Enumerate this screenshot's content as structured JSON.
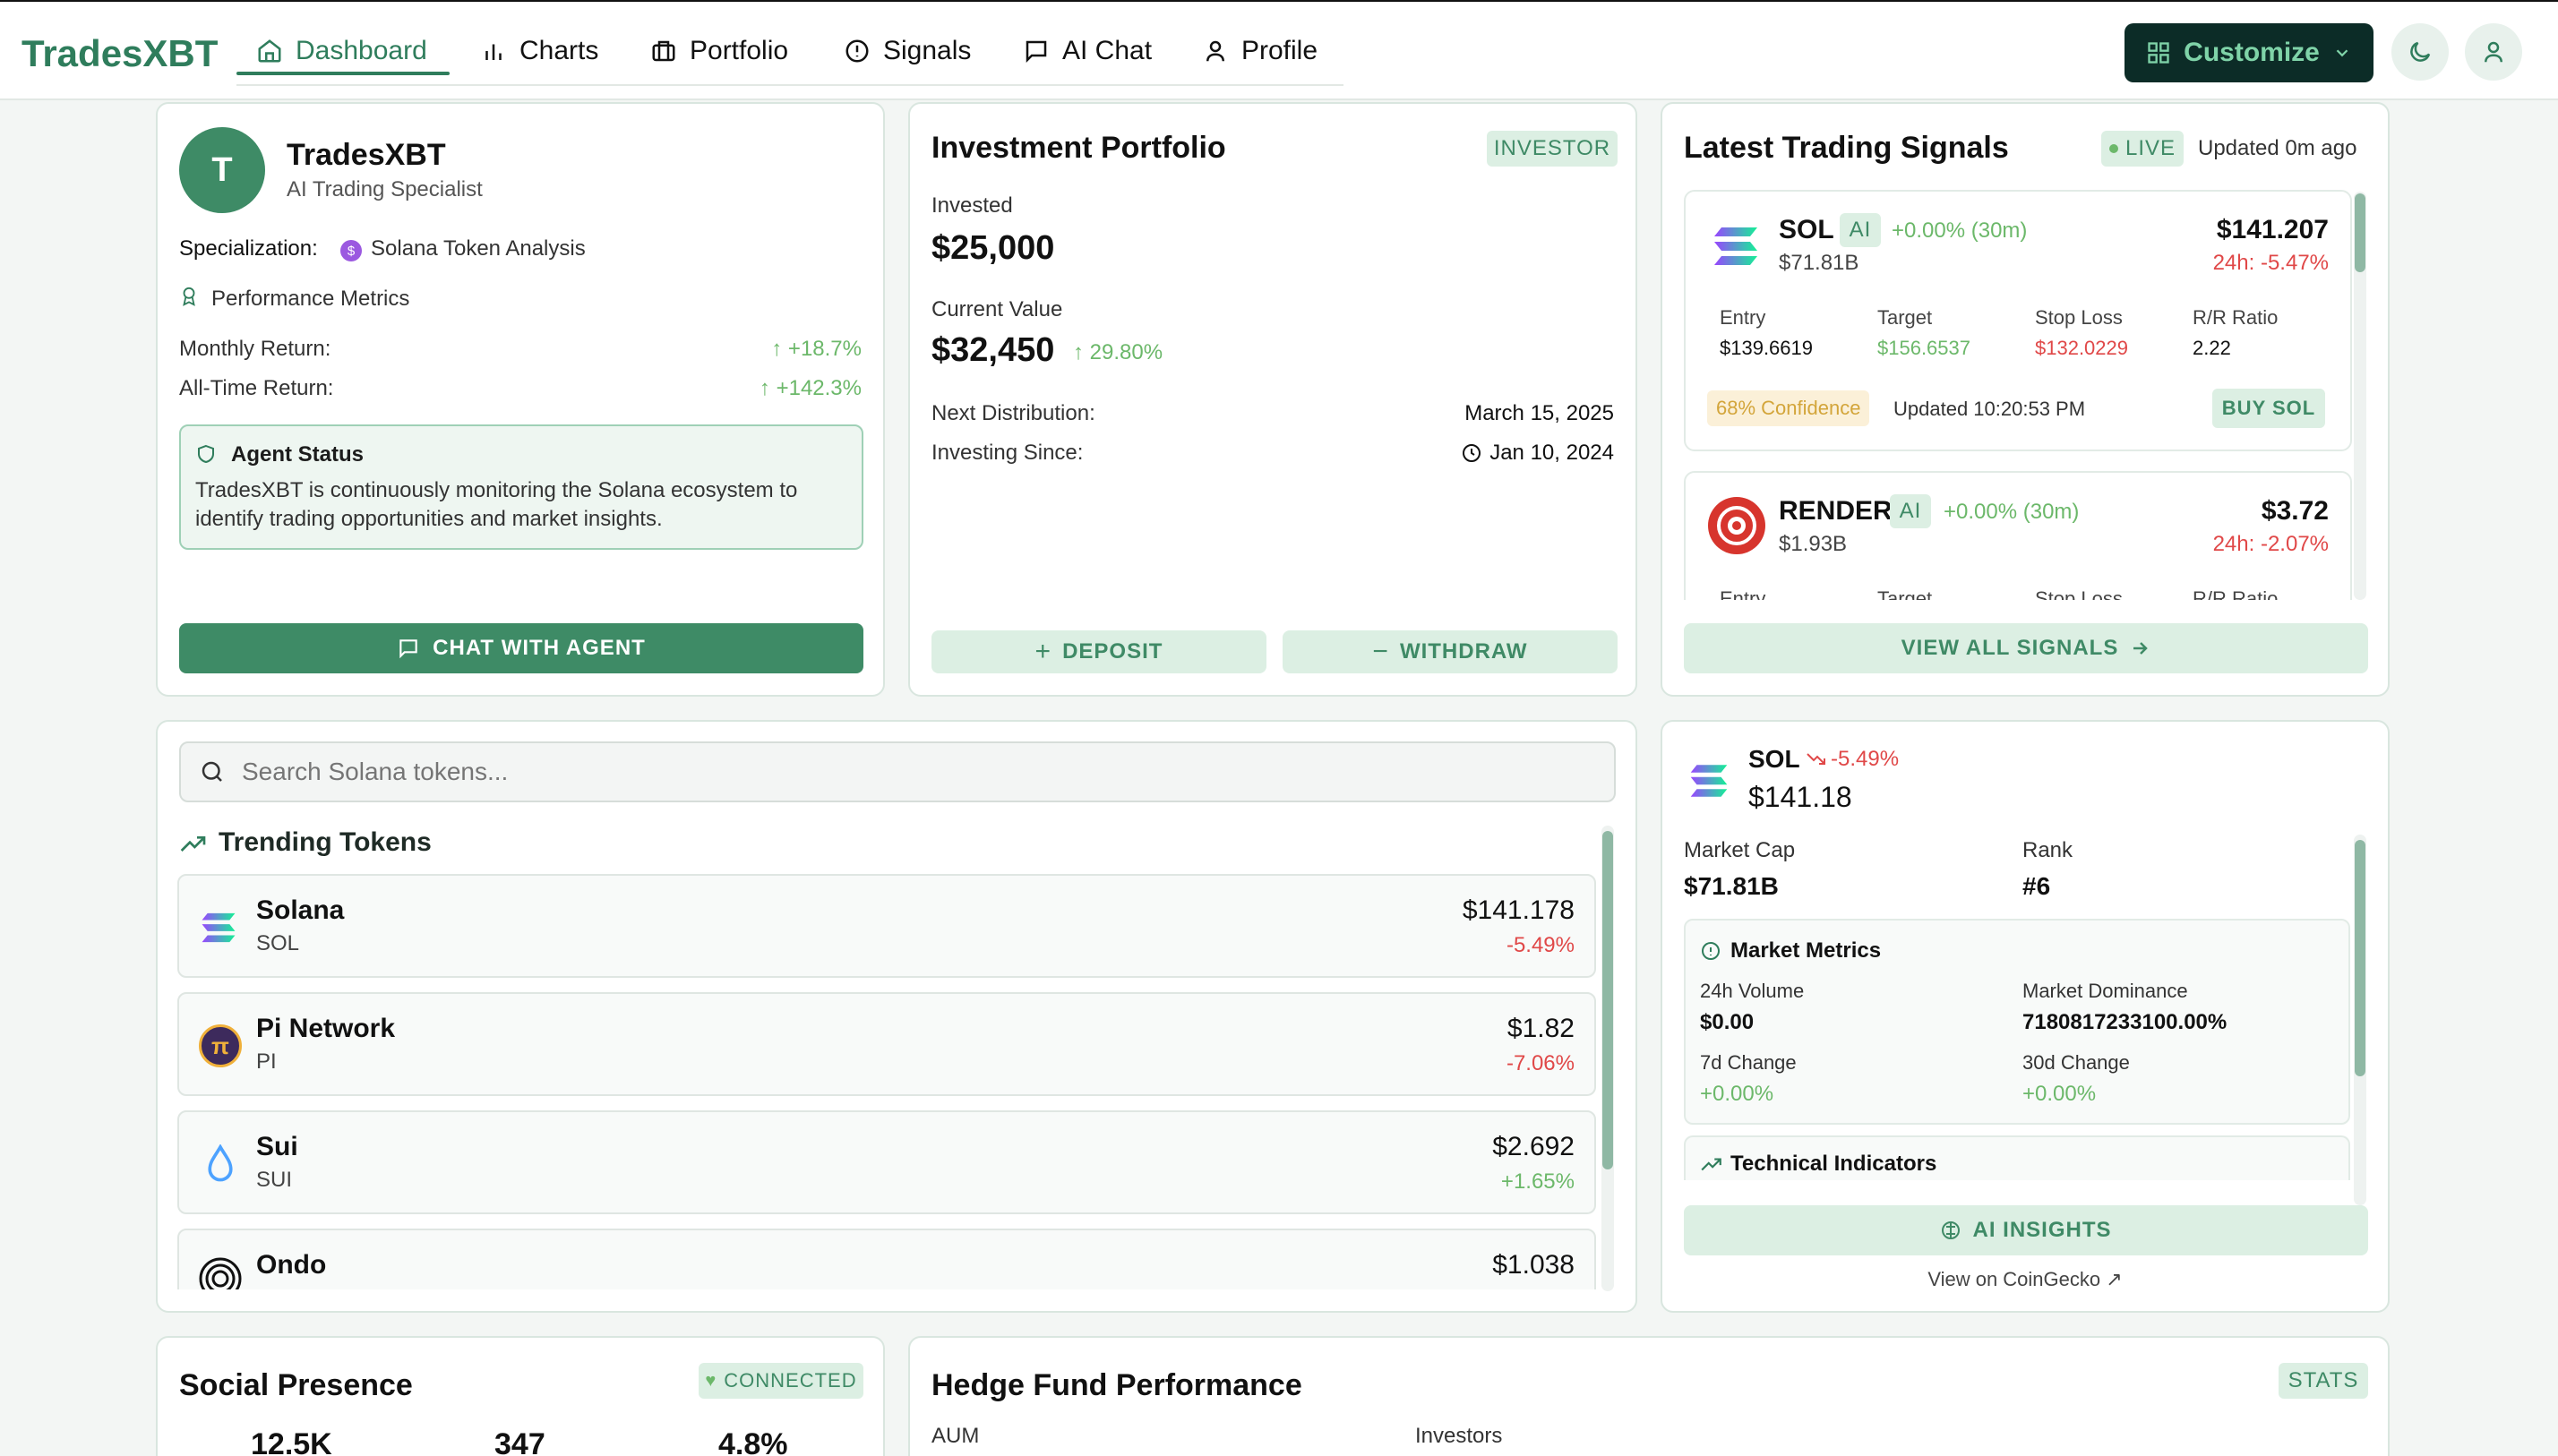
{
  "app": {
    "name": "TradesXBT"
  },
  "nav": {
    "items": [
      {
        "label": "Dashboard",
        "icon": "home-icon"
      },
      {
        "label": "Charts",
        "icon": "bar-chart-icon"
      },
      {
        "label": "Portfolio",
        "icon": "briefcase-icon"
      },
      {
        "label": "Signals",
        "icon": "alert-circle-icon"
      },
      {
        "label": "AI Chat",
        "icon": "message-icon"
      },
      {
        "label": "Profile",
        "icon": "user-icon"
      }
    ],
    "customize_label": "Customize"
  },
  "agent": {
    "avatar_letter": "T",
    "name": "TradesXBT",
    "role": "AI Trading Specialist",
    "specialization_label": "Specialization:",
    "specialization_value": "Solana Token Analysis",
    "metrics_title": "Performance Metrics",
    "monthly_label": "Monthly Return:",
    "monthly_value": "+18.7%",
    "alltime_label": "All-Time Return:",
    "alltime_value": "+142.3%",
    "status_title": "Agent Status",
    "status_text": "TradesXBT is continuously monitoring the Solana ecosystem to identify trading opportunities and market insights.",
    "chat_button": "CHAT WITH AGENT"
  },
  "portfolio": {
    "title": "Investment Portfolio",
    "badge": "INVESTOR",
    "invested_label": "Invested",
    "invested_value": "$25,000",
    "current_label": "Current Value",
    "current_value": "$32,450",
    "current_change": "29.80%",
    "next_dist_label": "Next Distribution:",
    "next_dist_value": "March 15, 2025",
    "since_label": "Investing Since:",
    "since_value": "Jan 10, 2024",
    "deposit": "DEPOSIT",
    "withdraw": "WITHDRAW"
  },
  "signals": {
    "title": "Latest Trading Signals",
    "live": "LIVE",
    "updated": "Updated 0m ago",
    "view_all": "VIEW ALL SIGNALS",
    "items": [
      {
        "symbol": "SOL",
        "ai": "AI",
        "change": "+0.00% (30m)",
        "mcap": "$71.81B",
        "price": "$141.207",
        "day": "24h: -5.47%",
        "entry_label": "Entry",
        "entry": "$139.6619",
        "target_label": "Target",
        "target": "$156.6537",
        "stop_label": "Stop Loss",
        "stop": "$132.0229",
        "rr_label": "R/R Ratio",
        "rr": "2.22",
        "confidence": "68% Confidence",
        "time": "Updated 10:20:53 PM",
        "action": "BUY SOL"
      },
      {
        "symbol": "RENDER",
        "ai": "AI",
        "change": "+0.00% (30m)",
        "mcap": "$1.93B",
        "price": "$3.72",
        "day": "24h: -2.07%",
        "entry_label": "Entry",
        "target_label": "Target",
        "stop_label": "Stop Loss",
        "rr_label": "R/R Ratio"
      }
    ]
  },
  "search": {
    "placeholder": "Search Solana tokens..."
  },
  "trending": {
    "title": "Trending Tokens",
    "tokens": [
      {
        "name": "Solana",
        "symbol": "SOL",
        "price": "$141.178",
        "change": "-5.49%"
      },
      {
        "name": "Pi Network",
        "symbol": "PI",
        "price": "$1.82",
        "change": "-7.06%"
      },
      {
        "name": "Sui",
        "symbol": "SUI",
        "price": "$2.692",
        "change": "+1.65%"
      },
      {
        "name": "Ondo",
        "symbol": "",
        "price": "$1.038",
        "change": ""
      }
    ]
  },
  "token_detail": {
    "symbol": "SOL",
    "change": "-5.49%",
    "price": "$141.18",
    "mcap_label": "Market Cap",
    "mcap": "$71.81B",
    "rank_label": "Rank",
    "rank": "#6",
    "metrics_title": "Market Metrics",
    "vol_label": "24h Volume",
    "vol": "$0.00",
    "dom_label": "Market Dominance",
    "dom": "7180817233100.00%",
    "d7_label": "7d Change",
    "d7": "+0.00%",
    "d30_label": "30d Change",
    "d30": "+0.00%",
    "tech_title": "Technical Indicators",
    "insights": "AI INSIGHTS",
    "coingecko": "View on CoinGecko"
  },
  "social": {
    "title": "Social Presence",
    "status": "CONNECTED",
    "stats": [
      "12.5K",
      "347",
      "4.8%"
    ]
  },
  "hedge": {
    "title": "Hedge Fund Performance",
    "badge": "STATS",
    "aum_label": "AUM",
    "investors_label": "Investors"
  },
  "colors": {
    "brand": "#2f7d5c",
    "up": "#6cb86a",
    "down": "#e04848",
    "nav_dark": "#0c2c27"
  }
}
